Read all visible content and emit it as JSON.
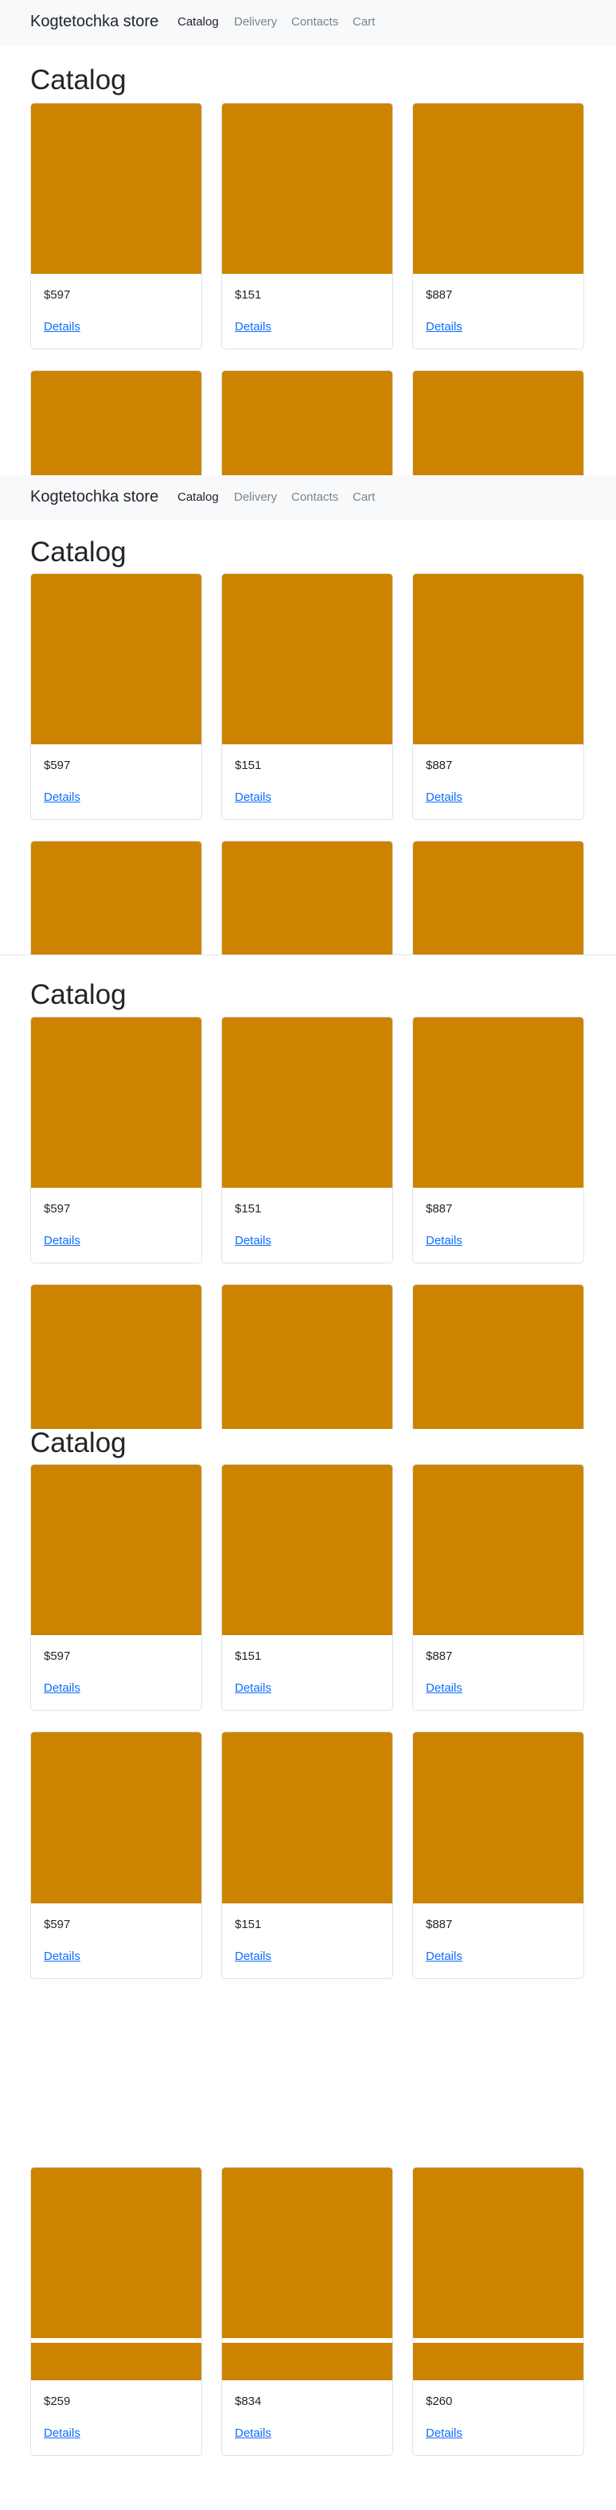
{
  "navbar": {
    "brand": "Kogtetochka store",
    "links": [
      {
        "label": "Catalog",
        "active": true
      },
      {
        "label": "Delivery",
        "active": false
      },
      {
        "label": "Contacts",
        "active": false
      },
      {
        "label": "Cart",
        "active": false
      }
    ]
  },
  "catalog": {
    "title": "Catalog",
    "details_label": "Details",
    "image_color": "#cc8300",
    "products": [
      {
        "price": "$597"
      },
      {
        "price": "$151"
      },
      {
        "price": "$887"
      },
      {
        "price": "$259"
      },
      {
        "price": "$834"
      },
      {
        "price": "$260"
      }
    ]
  },
  "colors": {
    "navbar_bg": "#f8f9fa",
    "link": "#0d6efd",
    "nav_inactive": "#7c8389",
    "text": "#212529"
  }
}
